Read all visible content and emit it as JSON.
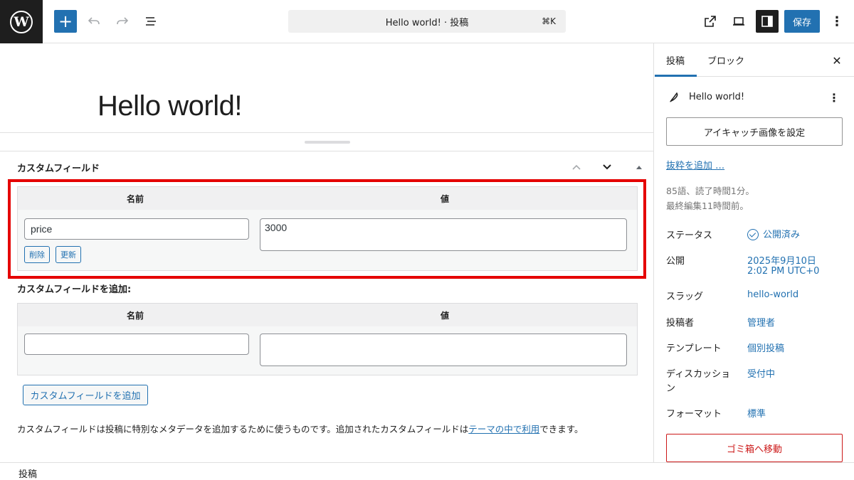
{
  "topbar": {
    "document_title": "Hello world! · 投稿",
    "shortcut": "⌘K",
    "save_label": "保存"
  },
  "editor": {
    "post_title": "Hello world!"
  },
  "custom_fields": {
    "heading": "カスタムフィールド",
    "existing": {
      "col_name": "名前",
      "col_value": "値",
      "name_value": "price",
      "value_value": "3000",
      "delete_label": "削除",
      "update_label": "更新"
    },
    "add_heading": "カスタムフィールドを追加:",
    "new": {
      "col_name": "名前",
      "col_value": "値",
      "name_value": "",
      "value_value": ""
    },
    "add_button_label": "カスタムフィールドを追加",
    "description_prefix": "カスタムフィールドは投稿に特別なメタデータを追加するために使うものです。追加されたカスタムフィールドは",
    "description_link": "テーマの中で利用",
    "description_suffix": "できます。"
  },
  "sidebar": {
    "tabs": [
      {
        "label": "投稿",
        "active": true
      },
      {
        "label": "ブロック",
        "active": false
      }
    ],
    "post_title": "Hello world!",
    "featured_image_button": "アイキャッチ画像を設定",
    "excerpt_link": "抜粋を追加 …",
    "word_info": "85語、読了時間1分。",
    "edit_info": "最終編集11時間前。",
    "rows": [
      {
        "label": "ステータス",
        "value": "公開済み"
      },
      {
        "label": "公開",
        "value": "2025年9月10日",
        "value2": "2:02 PM UTC+0"
      },
      {
        "label": "スラッグ",
        "value": "hello-world"
      },
      {
        "label": "投稿者",
        "value": "管理者"
      },
      {
        "label": "テンプレート",
        "value": "個別投稿"
      },
      {
        "label": "ディスカッショ",
        "label2": "ン",
        "value": "受付中"
      },
      {
        "label": "フォーマット",
        "value": "標準"
      }
    ],
    "trash_button": "ゴミ箱へ移動"
  },
  "footer": {
    "breadcrumb": "投稿"
  },
  "colors": {
    "accent": "#2271b1",
    "highlight": "#e50000",
    "danger": "#cc1818"
  }
}
